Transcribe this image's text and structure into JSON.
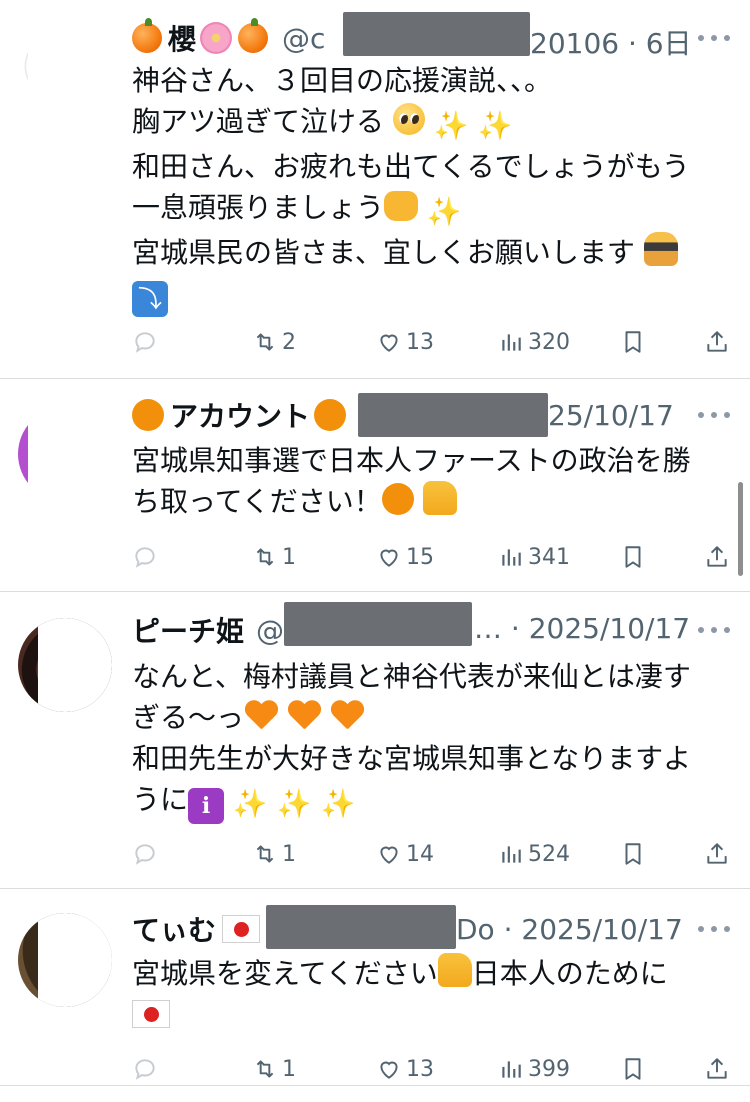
{
  "tweets": [
    {
      "name": "櫻",
      "handle_visible": "@c",
      "handle_tail": "20106",
      "date": "6日",
      "lines": [
        "神谷さん、３回目の応援演説、、。",
        "胸アツ過ぎて泣ける",
        "和田さん、お疲れも出てくるでしょうがもう",
        "一息頑張りましょう",
        "宮城県民の皆さま、宜しくお願いします"
      ],
      "replies": "",
      "reposts": "2",
      "likes": "13",
      "views": "320"
    },
    {
      "name": "アカウント",
      "date": "25/10/17",
      "lines": [
        "宮城県知事選で日本人ファーストの政治を勝",
        "ち取ってください！"
      ],
      "replies": "",
      "reposts": "1",
      "likes": "15",
      "views": "341"
    },
    {
      "name": "ピーチ姫",
      "handle_visible": "@",
      "date": "… · 2025/10/17",
      "lines": [
        "なんと、梅村議員と神谷代表が来仙とは凄す",
        "ぎる〜っ",
        "和田先生が大好きな宮城県知事となりますよ",
        "うに"
      ],
      "replies": "",
      "reposts": "1",
      "likes": "14",
      "views": "524"
    },
    {
      "name": "てぃむ",
      "handle_tail": "Do",
      "date": "· 2025/10/17",
      "lines": [
        "宮城県を変えてください",
        "日本人のために"
      ],
      "replies": "",
      "reposts": "1",
      "likes": "13",
      "views": "399"
    }
  ],
  "separator": "·",
  "icons": {
    "reply": "reply-icon",
    "repost": "repost-icon",
    "like": "heart-icon",
    "views": "views-icon",
    "bookmark": "bookmark-icon",
    "share": "share-icon",
    "more": "more-icon"
  },
  "colors": {
    "text": "#0f1419",
    "secondary": "#536471",
    "divider": "#d9dde0",
    "redaction": "#6b6e72"
  }
}
